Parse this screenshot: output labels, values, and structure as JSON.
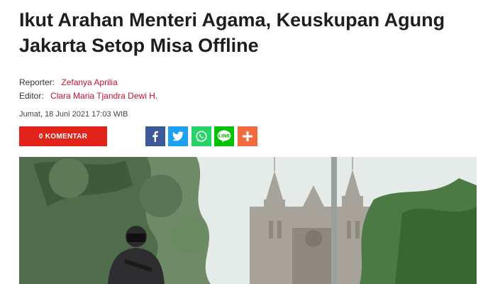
{
  "article": {
    "title_line1": "Ikut Arahan Menteri Agama, Keuskupan Agung",
    "title_line2": "Jakarta Setop Misa Offline",
    "reporter_label": "Reporter:",
    "reporter_name": "Zefanya Aprilia",
    "editor_label": "Editor:",
    "editor_name": "Clara Maria Tjandra Dewi H.",
    "date": "Jumat, 18 Juni 2021 17:03 WIB"
  },
  "actions": {
    "comment_label": "0 KOMENTAR",
    "share_icons": [
      "facebook-icon",
      "twitter-icon",
      "whatsapp-icon",
      "line-icon",
      "plus-icon"
    ]
  },
  "colors": {
    "accent": "#e2231a",
    "link": "#c8102e",
    "facebook": "#3b5998",
    "twitter": "#1da1f2",
    "whatsapp": "#25d366",
    "line": "#00c300",
    "more": "#f26a3f"
  }
}
